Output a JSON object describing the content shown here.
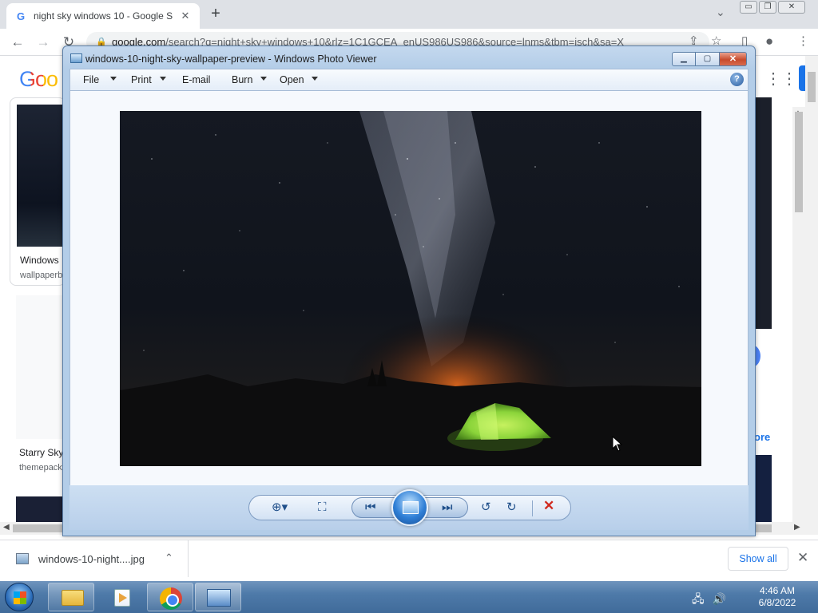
{
  "browser": {
    "tab_title": "night sky windows 10 - Google S",
    "new_tab": "+",
    "window_controls": [
      "▭",
      "❐",
      "✕"
    ],
    "url_host": "google.com",
    "url_path": "/search?q=night+sky+windows+10&rlz=1C1GCEA_enUS986US986&source=lnms&tbm=isch&sa=X"
  },
  "page": {
    "logo": "Goo",
    "results": [
      {
        "title": "Windows",
        "source": "wallpaperb"
      },
      {
        "title": "Starry Sky",
        "source": "themepack"
      }
    ],
    "more_link": "ore"
  },
  "photo_viewer": {
    "title": "windows-10-night-sky-wallpaper-preview - Windows Photo Viewer",
    "menu": [
      {
        "label": "File",
        "has_dropdown": true
      },
      {
        "label": "Print",
        "has_dropdown": true
      },
      {
        "label": "E-mail",
        "has_dropdown": false
      },
      {
        "label": "Burn",
        "has_dropdown": true
      },
      {
        "label": "Open",
        "has_dropdown": true
      }
    ],
    "help": "?",
    "controls": {
      "zoom": "zoom-icon",
      "fit": "actual-size-icon",
      "previous": "previous-icon",
      "slideshow": "slideshow-icon",
      "next": "next-icon",
      "rotate_ccw": "rotate-counterclockwise-icon",
      "rotate_cw": "rotate-clockwise-icon",
      "delete": "delete-icon"
    }
  },
  "download_bar": {
    "file_name": "windows-10-night....jpg",
    "show_all": "Show all"
  },
  "taskbar": {
    "time": "4:46 AM",
    "date": "6/8/2022",
    "pinned": [
      "Windows Explorer",
      "Windows Media Player",
      "Google Chrome",
      "Windows Photo Viewer"
    ]
  },
  "colors": {
    "accent": "#1a73e8",
    "tent": "#8bd43a",
    "horizon_glow": "#d8641c",
    "sky": "#0b0f17"
  }
}
